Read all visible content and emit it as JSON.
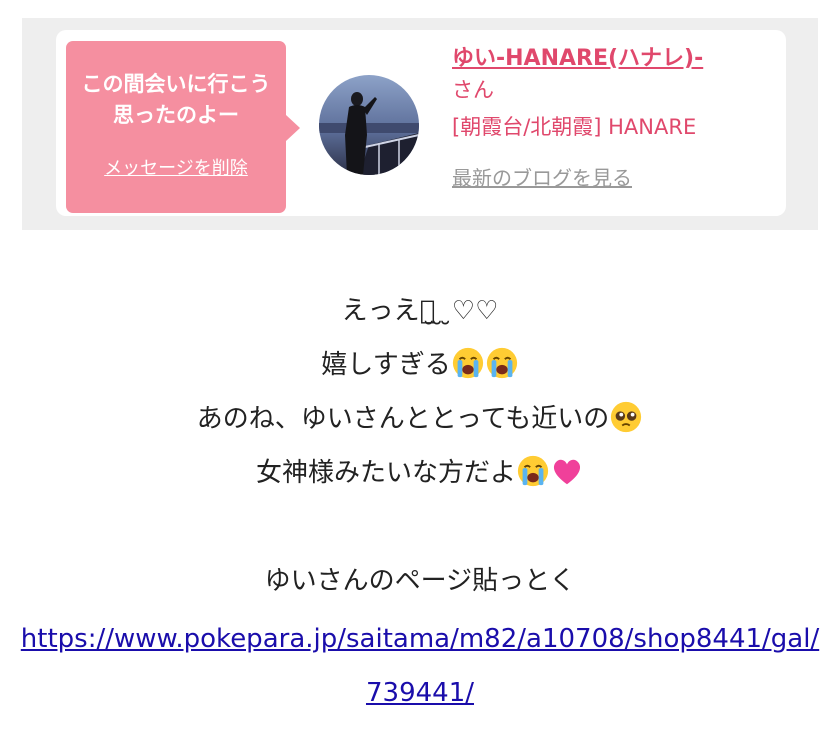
{
  "card": {
    "bubble_text": "この間会いに行こう思ったのよー",
    "delete_label": "メッセージを削除",
    "shop_name": "ゆい-HANARE(ハナレ)-",
    "honorific": "さん",
    "store_info": "[朝霞台/北朝霞] HANARE",
    "blog_link": "最新のブログを見る"
  },
  "message": {
    "line1": "えっえっ̮ ̮ ̮♡♡",
    "line2": "嬉しすぎる",
    "line3": "あのね、ゆいさんととっても近いの",
    "line4": "女神様みたいな方だよ",
    "line5": "ゆいさんのページ貼っとく",
    "url": "https://www.pokepara.jp/saitama/m82/a10708/shop8441/gal/739441/"
  },
  "icons": {
    "crying": "loudly-crying-face-icon",
    "pleading": "pleading-face-icon",
    "heart": "pink-heart-icon"
  },
  "colors": {
    "accent": "#e0486c",
    "bubble": "#f58fa0",
    "link": "#1a0dab"
  }
}
